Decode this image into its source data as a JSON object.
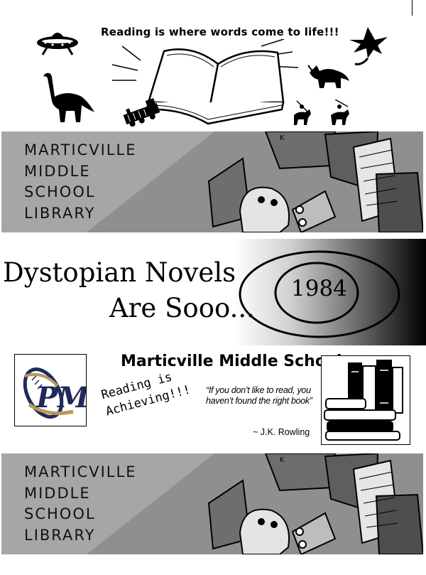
{
  "bookmark_reading": {
    "tagline": "Reading is where words come to life!!!"
  },
  "library_band": {
    "lines": [
      "MARTICVILLE",
      "MIDDLE",
      "SCHOOL",
      "LIBRARY"
    ]
  },
  "dystopian": {
    "line1": "Dystopian Novels",
    "line2": "Are Sooo...",
    "badge": "1984"
  },
  "marticville": {
    "title": "Marticville Middle School",
    "achieving_line1": "Reading is",
    "achieving_line2": "Achieving!!!",
    "quote": "“If you don’t like to read, you haven’t found the right book”",
    "quote_author": "~ J.K. Rowling",
    "logo_letters": "PM"
  }
}
